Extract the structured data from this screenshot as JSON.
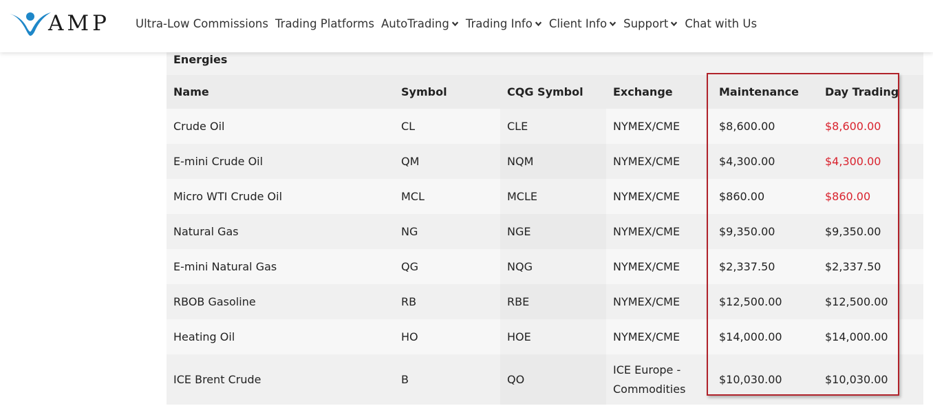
{
  "brand": {
    "logo_text": "AMP",
    "colors": {
      "logo_blue": "#1e87c8",
      "highlight": "#b0222a",
      "red_value": "#d9232e"
    }
  },
  "nav": {
    "items": [
      {
        "label": "Ultra-Low Commissions",
        "dropdown": false
      },
      {
        "label": "Trading Platforms",
        "dropdown": false
      },
      {
        "label": "AutoTrading",
        "dropdown": true
      },
      {
        "label": "Trading Info",
        "dropdown": true
      },
      {
        "label": "Client Info",
        "dropdown": true
      },
      {
        "label": "Support",
        "dropdown": true
      },
      {
        "label": "Chat with Us",
        "dropdown": false
      }
    ]
  },
  "table": {
    "section": "Energies",
    "headers": {
      "name": "Name",
      "symbol": "Symbol",
      "cqg": "CQG Symbol",
      "exchange": "Exchange",
      "maintenance": "Maintenance",
      "day_trading": "Day Trading"
    },
    "rows": [
      {
        "name": "Crude Oil",
        "symbol": "CL",
        "cqg": "CLE",
        "exchange": "NYMEX/CME",
        "maintenance": "$8,600.00",
        "day_trading": "$8,600.00",
        "day_red": true
      },
      {
        "name": "E-mini Crude Oil",
        "symbol": "QM",
        "cqg": "NQM",
        "exchange": "NYMEX/CME",
        "maintenance": "$4,300.00",
        "day_trading": "$4,300.00",
        "day_red": true
      },
      {
        "name": "Micro WTI Crude Oil",
        "symbol": "MCL",
        "cqg": "MCLE",
        "exchange": "NYMEX/CME",
        "maintenance": "$860.00",
        "day_trading": "$860.00",
        "day_red": true
      },
      {
        "name": "Natural Gas",
        "symbol": "NG",
        "cqg": "NGE",
        "exchange": "NYMEX/CME",
        "maintenance": "$9,350.00",
        "day_trading": "$9,350.00",
        "day_red": false
      },
      {
        "name": "E-mini Natural Gas",
        "symbol": "QG",
        "cqg": "NQG",
        "exchange": "NYMEX/CME",
        "maintenance": "$2,337.50",
        "day_trading": "$2,337.50",
        "day_red": false
      },
      {
        "name": "RBOB Gasoline",
        "symbol": "RB",
        "cqg": "RBE",
        "exchange": "NYMEX/CME",
        "maintenance": "$12,500.00",
        "day_trading": "$12,500.00",
        "day_red": false
      },
      {
        "name": "Heating Oil",
        "symbol": "HO",
        "cqg": "HOE",
        "exchange": "NYMEX/CME",
        "maintenance": "$14,000.00",
        "day_trading": "$14,000.00",
        "day_red": false
      },
      {
        "name": "ICE Brent Crude",
        "symbol": "B",
        "cqg": "QO",
        "exchange_line1": "ICE Europe -",
        "exchange_line2": "Commodities",
        "maintenance": "$10,030.00",
        "day_trading": "$10,030.00",
        "day_red": false
      }
    ]
  }
}
